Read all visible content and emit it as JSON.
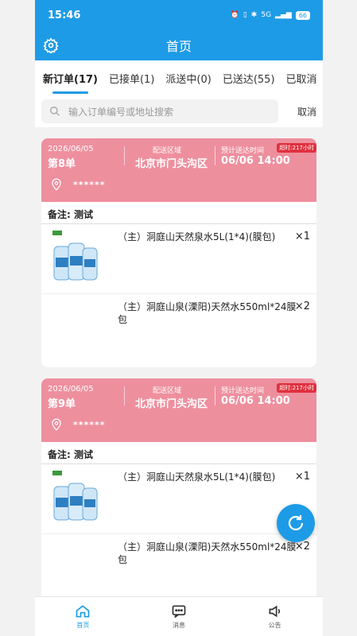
{
  "status": {
    "time": "15:46",
    "battery": "66",
    "signal": "5G"
  },
  "header": {
    "title": "首页"
  },
  "tabs": [
    {
      "label": "新订单(17)"
    },
    {
      "label": "已接单(1)"
    },
    {
      "label": "派送中(0)"
    },
    {
      "label": "已送达(55)"
    },
    {
      "label": "已取消"
    }
  ],
  "search": {
    "placeholder": "输入订单编号或地址搜索",
    "cancel": "取消"
  },
  "orders": [
    {
      "date": "2026/06/05",
      "number": "第8单",
      "area_label": "配送区域",
      "area": "北京市门头沟区",
      "eta_label": "预计送达时间",
      "eta": "06/06 14:00",
      "badge": "超时:217小时",
      "address": "******",
      "note": "备注: 测试",
      "items": [
        {
          "name": "（主）洞庭山天然泉水5L(1*4)(膜包)",
          "qty": "×1"
        },
        {
          "name": "（主）洞庭山泉(溧阳)天然水550ml*24膜包",
          "qty": "×2"
        }
      ]
    },
    {
      "date": "2026/06/05",
      "number": "第9单",
      "area_label": "配送区域",
      "area": "北京市门头沟区",
      "eta_label": "预计送达时间",
      "eta": "06/06 14:00",
      "badge": "超时:217小时",
      "address": "******",
      "note": "备注: 测试",
      "items": [
        {
          "name": "（主）洞庭山天然泉水5L(1*4)(膜包)",
          "qty": "×1"
        },
        {
          "name": "（主）洞庭山泉(溧阳)天然水550ml*24膜包",
          "qty": "×2"
        }
      ]
    }
  ],
  "nav": [
    {
      "label": "首页",
      "icon": "home-icon"
    },
    {
      "label": "消息",
      "icon": "message-icon"
    },
    {
      "label": "公告",
      "icon": "announcement-icon"
    }
  ],
  "colors": {
    "primary": "#1e9be6",
    "card_header": "#ee8f9e",
    "badge": "#e0303e"
  }
}
